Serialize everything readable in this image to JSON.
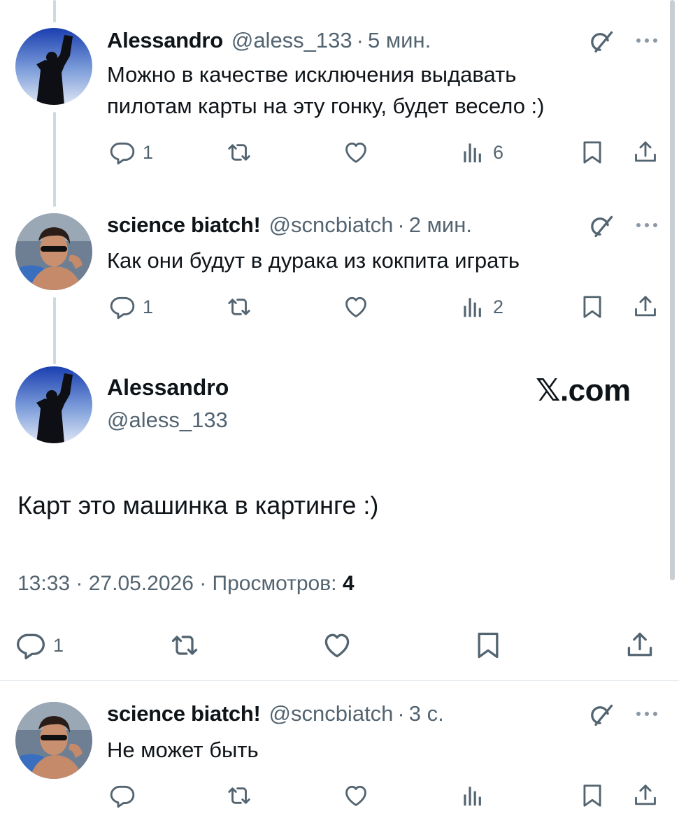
{
  "replies": [
    {
      "author": "Alessandro",
      "handle": "@aless_133",
      "time": "5 мин.",
      "text_lines": [
        "Можно в качестве исключения выдавать",
        "пилотам карты на эту гонку, будет весело :)"
      ],
      "replies_count": "1",
      "views_count": "6",
      "avatar": "silhouette-sunset"
    },
    {
      "author": "science biatch!",
      "handle": "@scncbiatch",
      "time": "2 мин.",
      "text_lines": [
        "Как они будут в дурака из кокпита играть"
      ],
      "replies_count": "1",
      "views_count": "2",
      "avatar": "person-sunglasses"
    }
  ],
  "main": {
    "author": "Alessandro",
    "handle": "@aless_133",
    "watermark": "𝕏.com",
    "text": "Карт это машинка в картинге :)",
    "timestamp": "13:33 · 27.05.2026 · Просмотров:",
    "views": "4",
    "replies_count": "1"
  },
  "last_reply": {
    "author": "science biatch!",
    "handle": "@scncbiatch",
    "time": "3 с.",
    "text": "Не может быть"
  },
  "separator": "·",
  "icons": {
    "reply": "reply-icon",
    "retweet": "retweet-icon",
    "like": "like-icon",
    "views": "views-icon",
    "bookmark": "bookmark-icon",
    "share": "share-icon",
    "grok": "grok-icon",
    "more": "more-icon"
  },
  "colors": {
    "text": "#0f1419",
    "secondary": "#536471",
    "thread_line": "#cfd9de"
  }
}
